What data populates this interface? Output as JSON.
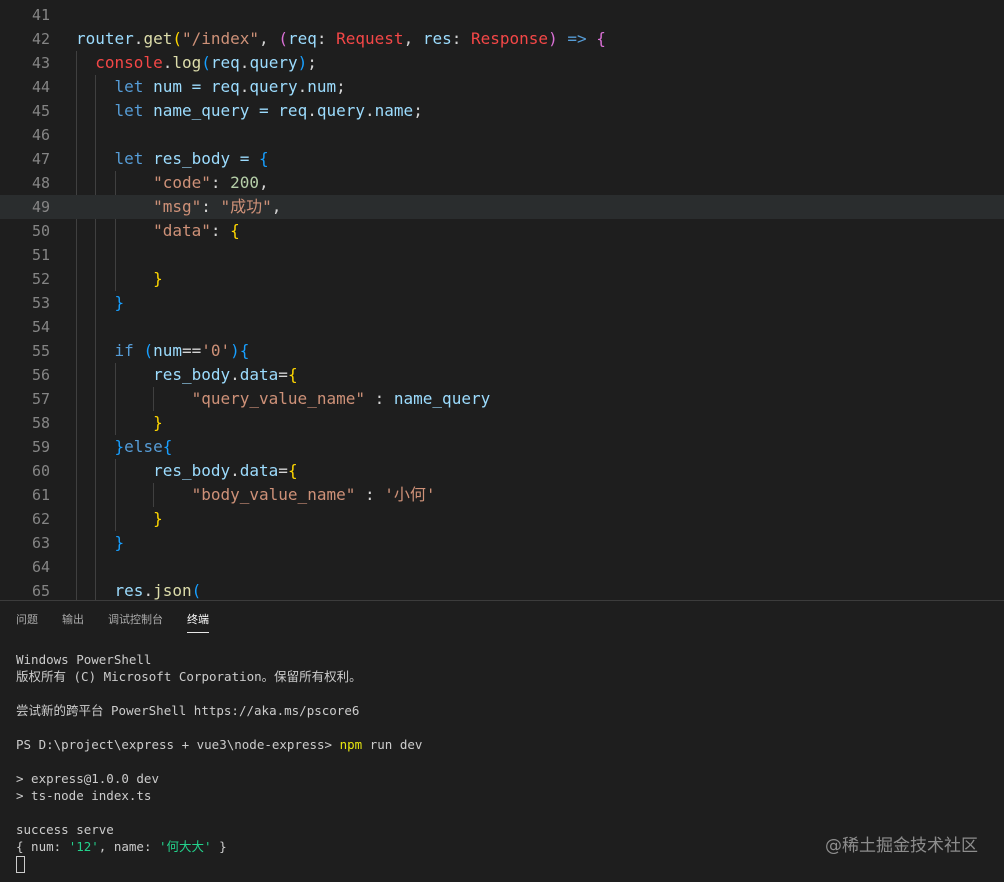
{
  "editor": {
    "highlighted_line": "49",
    "lines": [
      {
        "n": "41",
        "tokens": []
      },
      {
        "n": "42",
        "tokens": [
          {
            "t": "router",
            "c": "#9cdcfe"
          },
          {
            "t": ".",
            "c": "#d4d4d4"
          },
          {
            "t": "get",
            "c": "#dcdcaa"
          },
          {
            "t": "(",
            "c": "#ffd700"
          },
          {
            "t": "\"/index\"",
            "c": "#ce9178"
          },
          {
            "t": ", ",
            "c": "#d4d4d4"
          },
          {
            "t": "(",
            "c": "#da70d6"
          },
          {
            "t": "req",
            "c": "#9cdcfe"
          },
          {
            "t": ": ",
            "c": "#d4d4d4"
          },
          {
            "t": "Request",
            "c": "#f44747"
          },
          {
            "t": ", ",
            "c": "#d4d4d4"
          },
          {
            "t": "res",
            "c": "#9cdcfe"
          },
          {
            "t": ": ",
            "c": "#d4d4d4"
          },
          {
            "t": "Response",
            "c": "#f44747"
          },
          {
            "t": ")",
            "c": "#da70d6"
          },
          {
            "t": " => ",
            "c": "#569cd6"
          },
          {
            "t": "{",
            "c": "#da70d6"
          }
        ]
      },
      {
        "n": "43",
        "tokens": [
          {
            "t": "  ",
            "c": "#d4d4d4"
          },
          {
            "t": "console",
            "c": "#f44747"
          },
          {
            "t": ".",
            "c": "#d4d4d4"
          },
          {
            "t": "log",
            "c": "#dcdcaa"
          },
          {
            "t": "(",
            "c": "#179fff"
          },
          {
            "t": "req",
            "c": "#9cdcfe"
          },
          {
            "t": ".",
            "c": "#d4d4d4"
          },
          {
            "t": "query",
            "c": "#9cdcfe"
          },
          {
            "t": ")",
            "c": "#179fff"
          },
          {
            "t": ";",
            "c": "#d4d4d4"
          }
        ]
      },
      {
        "n": "44",
        "tokens": [
          {
            "t": "    ",
            "c": "#d4d4d4"
          },
          {
            "t": "let",
            "c": "#569cd6"
          },
          {
            "t": " num = ",
            "c": "#9cdcfe"
          },
          {
            "t": "req",
            "c": "#9cdcfe"
          },
          {
            "t": ".",
            "c": "#d4d4d4"
          },
          {
            "t": "query",
            "c": "#9cdcfe"
          },
          {
            "t": ".",
            "c": "#d4d4d4"
          },
          {
            "t": "num",
            "c": "#9cdcfe"
          },
          {
            "t": ";",
            "c": "#d4d4d4"
          }
        ]
      },
      {
        "n": "45",
        "tokens": [
          {
            "t": "    ",
            "c": "#d4d4d4"
          },
          {
            "t": "let",
            "c": "#569cd6"
          },
          {
            "t": " name_query = ",
            "c": "#9cdcfe"
          },
          {
            "t": "req",
            "c": "#9cdcfe"
          },
          {
            "t": ".",
            "c": "#d4d4d4"
          },
          {
            "t": "query",
            "c": "#9cdcfe"
          },
          {
            "t": ".",
            "c": "#d4d4d4"
          },
          {
            "t": "name",
            "c": "#9cdcfe"
          },
          {
            "t": ";",
            "c": "#d4d4d4"
          }
        ]
      },
      {
        "n": "46",
        "tokens": []
      },
      {
        "n": "47",
        "tokens": [
          {
            "t": "    ",
            "c": "#d4d4d4"
          },
          {
            "t": "let",
            "c": "#569cd6"
          },
          {
            "t": " res_body = ",
            "c": "#9cdcfe"
          },
          {
            "t": "{",
            "c": "#179fff"
          }
        ]
      },
      {
        "n": "48",
        "tokens": [
          {
            "t": "        ",
            "c": "#d4d4d4"
          },
          {
            "t": "\"code\"",
            "c": "#ce9178"
          },
          {
            "t": ": ",
            "c": "#d4d4d4"
          },
          {
            "t": "200",
            "c": "#b5cea8"
          },
          {
            "t": ",",
            "c": "#d4d4d4"
          }
        ]
      },
      {
        "n": "49",
        "tokens": [
          {
            "t": "        ",
            "c": "#d4d4d4"
          },
          {
            "t": "\"msg\"",
            "c": "#ce9178"
          },
          {
            "t": ": ",
            "c": "#d4d4d4"
          },
          {
            "t": "\"成功\"",
            "c": "#ce9178"
          },
          {
            "t": ",",
            "c": "#d4d4d4"
          }
        ]
      },
      {
        "n": "50",
        "tokens": [
          {
            "t": "        ",
            "c": "#d4d4d4"
          },
          {
            "t": "\"data\"",
            "c": "#ce9178"
          },
          {
            "t": ": ",
            "c": "#d4d4d4"
          },
          {
            "t": "{",
            "c": "#ffd700"
          }
        ]
      },
      {
        "n": "51",
        "tokens": []
      },
      {
        "n": "52",
        "tokens": [
          {
            "t": "        ",
            "c": "#d4d4d4"
          },
          {
            "t": "}",
            "c": "#ffd700"
          }
        ]
      },
      {
        "n": "53",
        "tokens": [
          {
            "t": "    ",
            "c": "#d4d4d4"
          },
          {
            "t": "}",
            "c": "#179fff"
          }
        ]
      },
      {
        "n": "54",
        "tokens": []
      },
      {
        "n": "55",
        "tokens": [
          {
            "t": "    ",
            "c": "#d4d4d4"
          },
          {
            "t": "if",
            "c": "#569cd6"
          },
          {
            "t": " ",
            "c": "#d4d4d4"
          },
          {
            "t": "(",
            "c": "#179fff"
          },
          {
            "t": "num",
            "c": "#9cdcfe"
          },
          {
            "t": "==",
            "c": "#d4d4d4"
          },
          {
            "t": "'0'",
            "c": "#ce9178"
          },
          {
            "t": ")",
            "c": "#179fff"
          },
          {
            "t": "{",
            "c": "#179fff"
          }
        ]
      },
      {
        "n": "56",
        "tokens": [
          {
            "t": "        ",
            "c": "#d4d4d4"
          },
          {
            "t": "res_body",
            "c": "#9cdcfe"
          },
          {
            "t": ".",
            "c": "#d4d4d4"
          },
          {
            "t": "data",
            "c": "#9cdcfe"
          },
          {
            "t": "=",
            "c": "#d4d4d4"
          },
          {
            "t": "{",
            "c": "#ffd700"
          }
        ]
      },
      {
        "n": "57",
        "tokens": [
          {
            "t": "            ",
            "c": "#d4d4d4"
          },
          {
            "t": "\"query_value_name\"",
            "c": "#ce9178"
          },
          {
            "t": " : ",
            "c": "#d4d4d4"
          },
          {
            "t": "name_query",
            "c": "#9cdcfe"
          }
        ]
      },
      {
        "n": "58",
        "tokens": [
          {
            "t": "        ",
            "c": "#d4d4d4"
          },
          {
            "t": "}",
            "c": "#ffd700"
          }
        ]
      },
      {
        "n": "59",
        "tokens": [
          {
            "t": "    ",
            "c": "#d4d4d4"
          },
          {
            "t": "}",
            "c": "#179fff"
          },
          {
            "t": "else",
            "c": "#569cd6"
          },
          {
            "t": "{",
            "c": "#179fff"
          }
        ]
      },
      {
        "n": "60",
        "tokens": [
          {
            "t": "        ",
            "c": "#d4d4d4"
          },
          {
            "t": "res_body",
            "c": "#9cdcfe"
          },
          {
            "t": ".",
            "c": "#d4d4d4"
          },
          {
            "t": "data",
            "c": "#9cdcfe"
          },
          {
            "t": "=",
            "c": "#d4d4d4"
          },
          {
            "t": "{",
            "c": "#ffd700"
          }
        ]
      },
      {
        "n": "61",
        "tokens": [
          {
            "t": "            ",
            "c": "#d4d4d4"
          },
          {
            "t": "\"body_value_name\"",
            "c": "#ce9178"
          },
          {
            "t": " : ",
            "c": "#d4d4d4"
          },
          {
            "t": "'小何'",
            "c": "#ce9178"
          }
        ]
      },
      {
        "n": "62",
        "tokens": [
          {
            "t": "        ",
            "c": "#d4d4d4"
          },
          {
            "t": "}",
            "c": "#ffd700"
          }
        ]
      },
      {
        "n": "63",
        "tokens": [
          {
            "t": "    ",
            "c": "#d4d4d4"
          },
          {
            "t": "}",
            "c": "#179fff"
          }
        ]
      },
      {
        "n": "64",
        "tokens": []
      },
      {
        "n": "65",
        "tokens": [
          {
            "t": "    ",
            "c": "#d4d4d4"
          },
          {
            "t": "res",
            "c": "#9cdcfe"
          },
          {
            "t": ".",
            "c": "#d4d4d4"
          },
          {
            "t": "json",
            "c": "#dcdcaa"
          },
          {
            "t": "(",
            "c": "#179fff"
          }
        ]
      }
    ]
  },
  "panel": {
    "tabs": [
      {
        "label": "问题",
        "active": false
      },
      {
        "label": "输出",
        "active": false
      },
      {
        "label": "调试控制台",
        "active": false
      },
      {
        "label": "终端",
        "active": true
      }
    ]
  },
  "terminal": {
    "lines": [
      [
        {
          "t": "Windows PowerShell",
          "c": "#cccccc"
        }
      ],
      [
        {
          "t": "版权所有 (C) Microsoft Corporation。保留所有权利。",
          "c": "#cccccc"
        }
      ],
      [],
      [
        {
          "t": "尝试新的跨平台 PowerShell https://aka.ms/pscore6",
          "c": "#cccccc"
        }
      ],
      [],
      [
        {
          "t": "PS D:\\project\\express + vue3\\node-express> ",
          "c": "#cccccc"
        },
        {
          "t": "npm",
          "c": "#e5e510"
        },
        {
          "t": " run dev",
          "c": "#cccccc"
        }
      ],
      [],
      [
        {
          "t": "> express@1.0.0 dev",
          "c": "#cccccc"
        }
      ],
      [
        {
          "t": "> ts-node index.ts",
          "c": "#cccccc"
        }
      ],
      [],
      [
        {
          "t": "success serve",
          "c": "#cccccc"
        }
      ],
      [
        {
          "t": "{ num: ",
          "c": "#cccccc"
        },
        {
          "t": "'12'",
          "c": "#23d18b"
        },
        {
          "t": ", name: ",
          "c": "#cccccc"
        },
        {
          "t": "'何大大'",
          "c": "#23d18b"
        },
        {
          "t": " }",
          "c": "#cccccc"
        }
      ]
    ]
  },
  "watermark": "@稀土掘金技术社区"
}
